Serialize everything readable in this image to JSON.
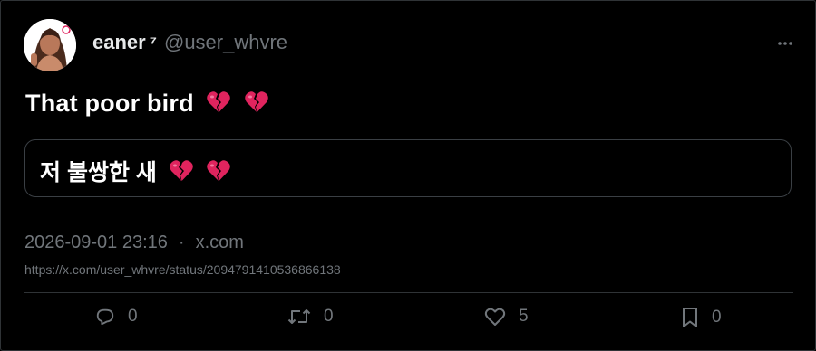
{
  "author": {
    "display_name": "eaner",
    "badge": "⁷",
    "handle": "@user_whvre"
  },
  "tweet": {
    "text": "That poor bird",
    "translation": "저 불쌍한 새"
  },
  "meta": {
    "timestamp": "2026-09-01 23:16",
    "separator": "·",
    "source": "x.com",
    "url": "https://x.com/user_whvre/status/2094791410536866138"
  },
  "actions": {
    "replies": "0",
    "reposts": "0",
    "likes": "5",
    "bookmarks": "0"
  },
  "icons": {
    "emoji": "broken-heart-icon",
    "reply": "reply-icon",
    "repost": "repost-icon",
    "like": "heart-icon",
    "bookmark": "bookmark-icon",
    "more": "more-icon"
  },
  "colors": {
    "background": "#000000",
    "text": "#e7e9ea",
    "muted": "#71767b",
    "border": "#2f3336",
    "emoji_pink": "#e0245e"
  }
}
